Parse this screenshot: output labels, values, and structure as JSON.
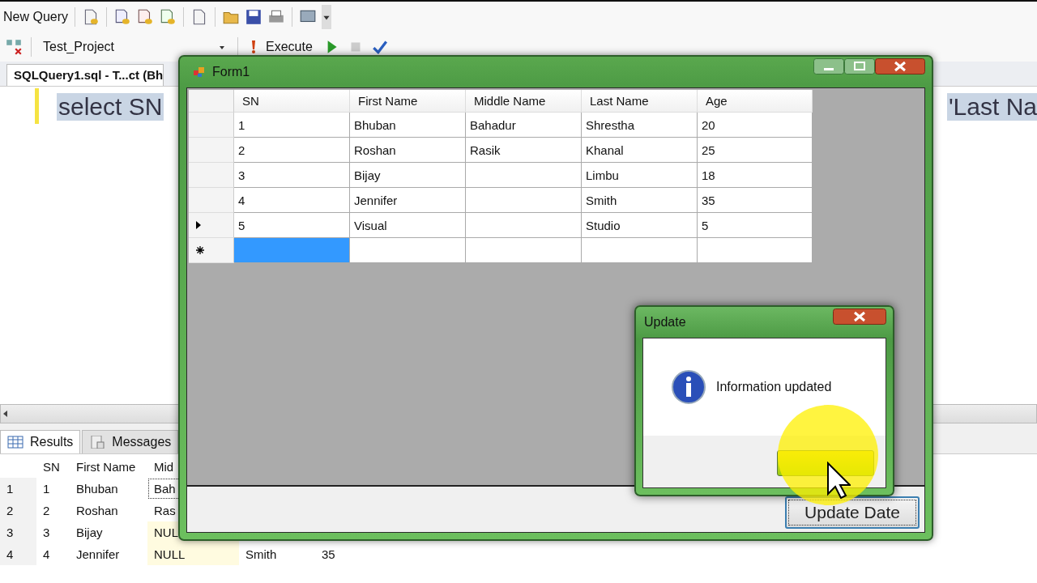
{
  "ssms": {
    "toolbar": {
      "new_query": "New Query",
      "database": "Test_Project",
      "execute": "Execute"
    },
    "query_tab": "SQLQuery1.sql - T...ct (Bh",
    "editor": {
      "left_text": "select SN",
      "right_text": "'Last Na"
    },
    "result_tabs": [
      {
        "label": "Results",
        "selected": true
      },
      {
        "label": "Messages",
        "selected": false
      }
    ],
    "results": {
      "columns": [
        "SN",
        "First Name",
        "Mid"
      ],
      "rows": [
        {
          "num": "1",
          "cells": [
            "1",
            "Bhuban",
            "Bah"
          ]
        },
        {
          "num": "2",
          "cells": [
            "2",
            "Roshan",
            "Ras"
          ]
        },
        {
          "num": "3",
          "cells": [
            "3",
            "Bijay",
            "NUL"
          ]
        },
        {
          "num": "4",
          "cells": [
            "4",
            "Jennifer",
            "NULL",
            "Smith",
            "35"
          ]
        }
      ]
    }
  },
  "form1": {
    "title": "Form1",
    "columns": [
      "SN",
      "First Name",
      "Middle Name",
      "Last Name",
      "Age"
    ],
    "rows": [
      {
        "current": false,
        "cells": [
          "1",
          "Bhuban",
          "Bahadur",
          "Shrestha",
          "20"
        ]
      },
      {
        "current": false,
        "cells": [
          "2",
          "Roshan",
          "Rasik",
          "Khanal",
          "25"
        ]
      },
      {
        "current": false,
        "cells": [
          "3",
          "Bijay",
          "",
          "Limbu",
          "18"
        ]
      },
      {
        "current": false,
        "cells": [
          "4",
          "Jennifer",
          "",
          "Smith",
          "35"
        ]
      },
      {
        "current": true,
        "cells": [
          "5",
          "Visual",
          "",
          "Studio",
          "5"
        ]
      }
    ],
    "new_row": {
      "cells_selected": [
        true,
        false,
        false,
        false,
        false
      ]
    },
    "button": "Update Date"
  },
  "dialog": {
    "title": "Update",
    "message": "Information updated"
  }
}
